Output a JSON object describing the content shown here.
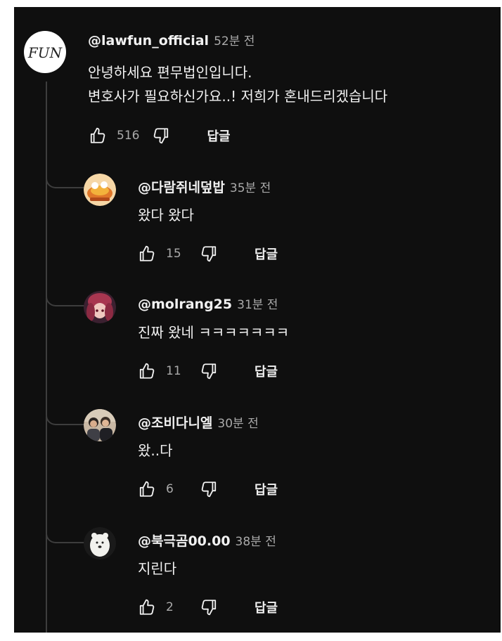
{
  "colors": {
    "background": "#0f0f0f",
    "text_primary": "#f1f1f1",
    "text_secondary": "#aaaaaa",
    "thread_line": "#3d3d3d"
  },
  "icons": {
    "like": "thumbs-up-icon",
    "dislike": "thumbs-down-icon"
  },
  "main_comment": {
    "avatar_text": "FUN",
    "handle": "@lawfun_official",
    "time": "52분 전",
    "lines": [
      "안녕하세요 편무법인입니다.",
      "변호사가 필요하신가요..! 저희가 혼내드리겠습니다"
    ],
    "likes": "516",
    "reply_label": "답글"
  },
  "replies": [
    {
      "handle": "@다람쥐네덮밥",
      "time": "35분 전",
      "text": "왔다 왔다",
      "likes": "15",
      "reply_label": "답글"
    },
    {
      "handle": "@molrang25",
      "time": "31분 전",
      "text": "진짜 왔네 ㅋㅋㅋㅋㅋㅋㅋ",
      "likes": "11",
      "reply_label": "답글"
    },
    {
      "handle": "@조비다니엘",
      "time": "30분 전",
      "text": "왔..다",
      "likes": "6",
      "reply_label": "답글"
    },
    {
      "handle": "@북극곰00.00",
      "time": "38분 전",
      "text": "지린다",
      "likes": "2",
      "reply_label": "답글"
    }
  ]
}
